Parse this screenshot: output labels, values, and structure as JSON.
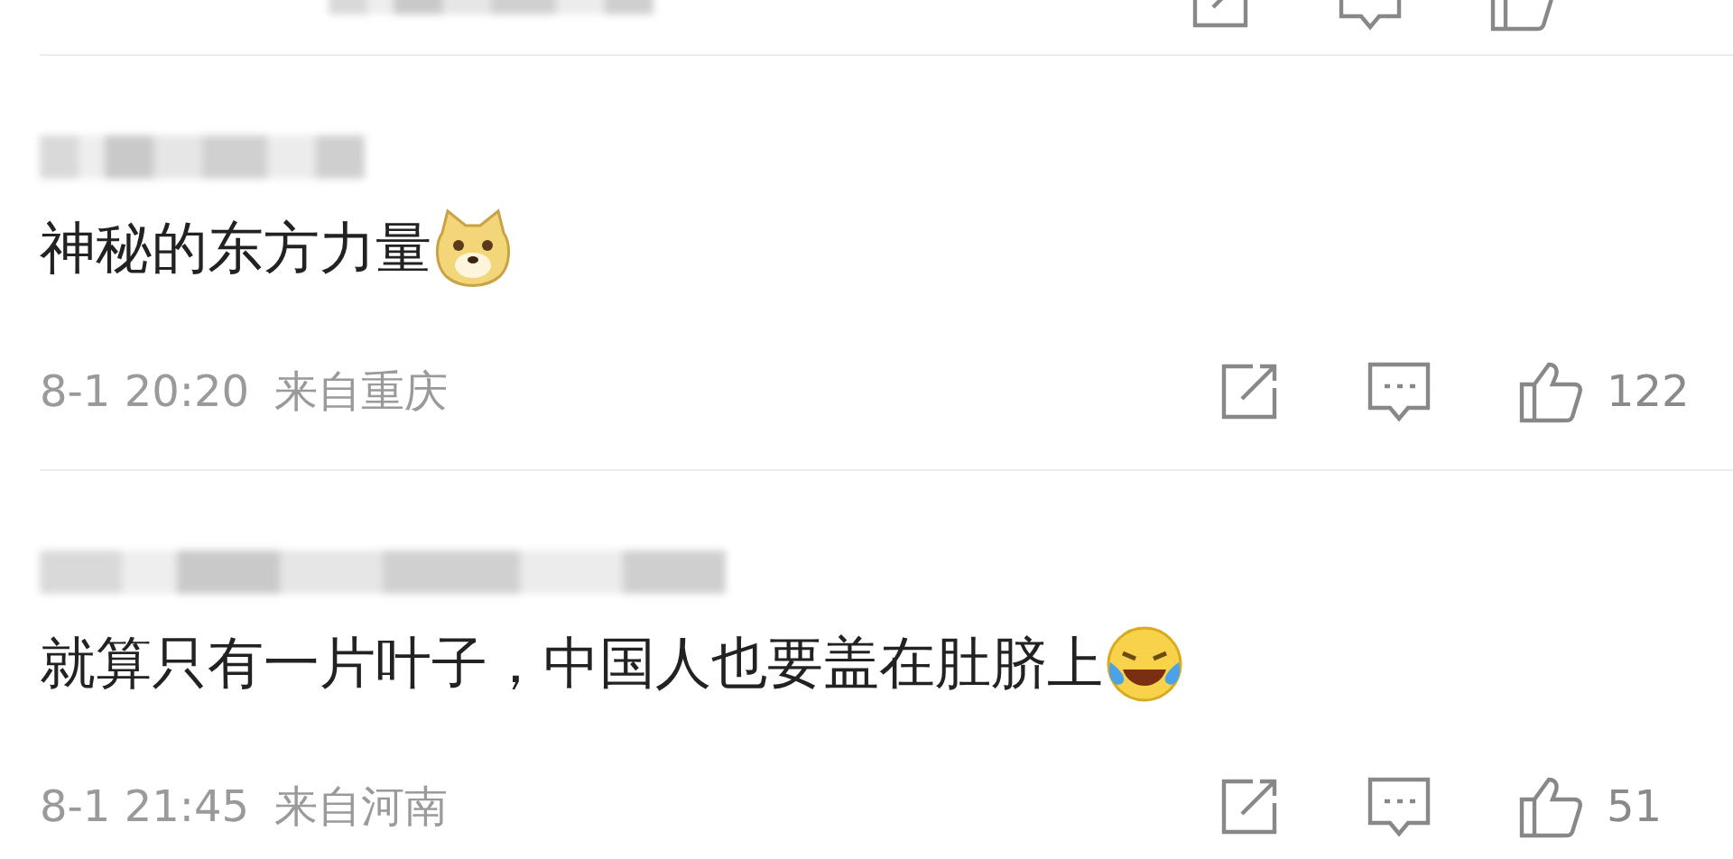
{
  "comments": [
    {
      "text": "神秘的东方力量",
      "emoji": {
        "kind": "dog"
      },
      "time": "8-1 20:20",
      "location": "来自重庆",
      "likes": "122"
    },
    {
      "text": "就算只有一片叶子，中国人也要盖在肚脐上",
      "emoji": {
        "kind": "laugh"
      },
      "time": "8-1 21:45",
      "location": "来自河南",
      "likes": "51"
    }
  ]
}
